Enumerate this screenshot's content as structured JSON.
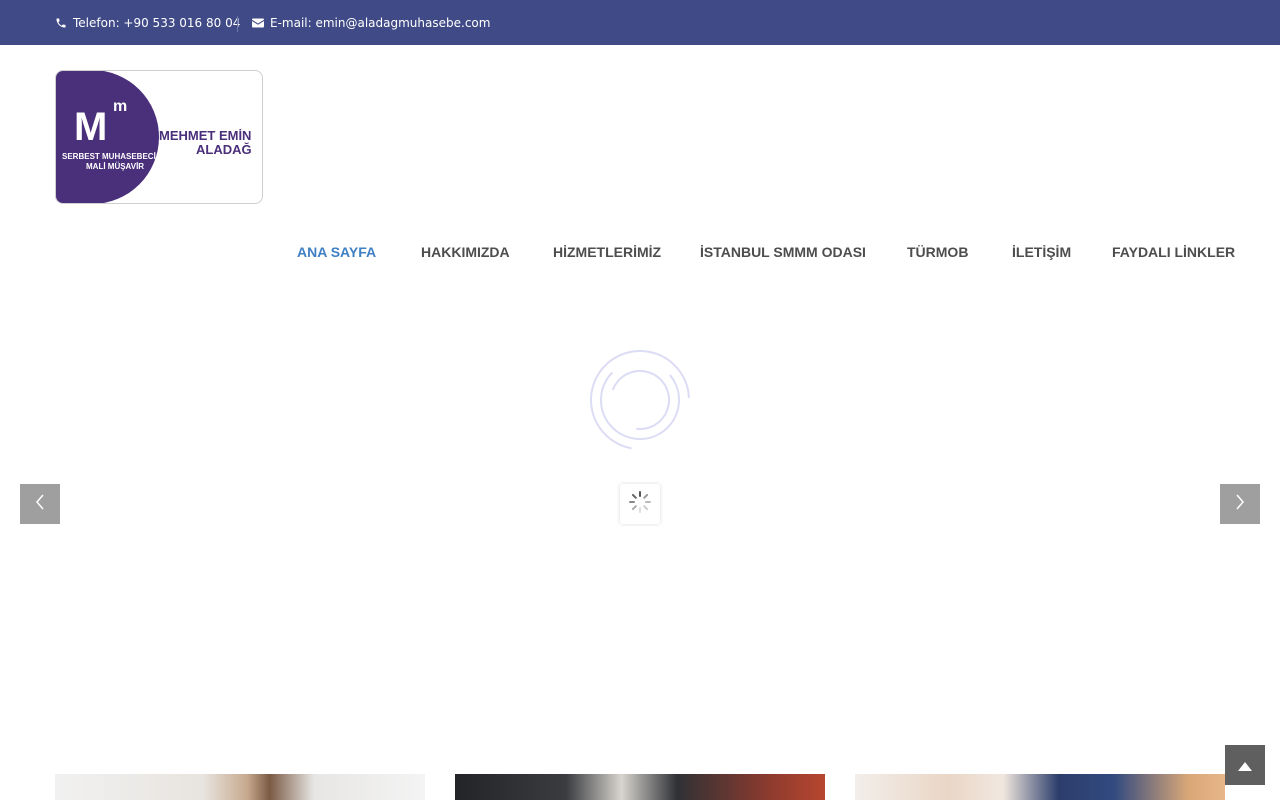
{
  "topbar": {
    "phone": "Telefon: +90 533 016 80 04",
    "email": "E-mail: emin@aladagmuhasebe.com",
    "phone_icon": "phone-icon",
    "email_icon": "envelope-icon"
  },
  "logo": {
    "big_letter": "M",
    "small_letter": "m",
    "subtitle_line1": "SERBEST MUHASEBECİ",
    "subtitle_line2": "MALİ MÜŞAVİR",
    "name_line1": "MEHMET EMİN",
    "name_line2": "ALADAĞ"
  },
  "nav": {
    "items": [
      {
        "label": "ANA SAYFA",
        "active": true
      },
      {
        "label": "HAKKIMIZDA",
        "active": false
      },
      {
        "label": "HİZMETLERİMİZ",
        "active": false
      },
      {
        "label": "İSTANBUL SMMM ODASI",
        "active": false
      },
      {
        "label": "TÜRMOB",
        "active": false
      },
      {
        "label": "İLETİŞİM",
        "active": false
      },
      {
        "label": "FAYDALI LİNKLER",
        "active": false
      }
    ]
  },
  "slider": {
    "prev_icon": "chevron-left-icon",
    "next_icon": "chevron-right-icon",
    "loading_icon": "spinner-icon"
  },
  "colors": {
    "topbar": "#3f4a87",
    "accent": "#3f7fc4",
    "brand": "#4a2f7a"
  },
  "scroll_to_top_icon": "chevron-up-icon"
}
